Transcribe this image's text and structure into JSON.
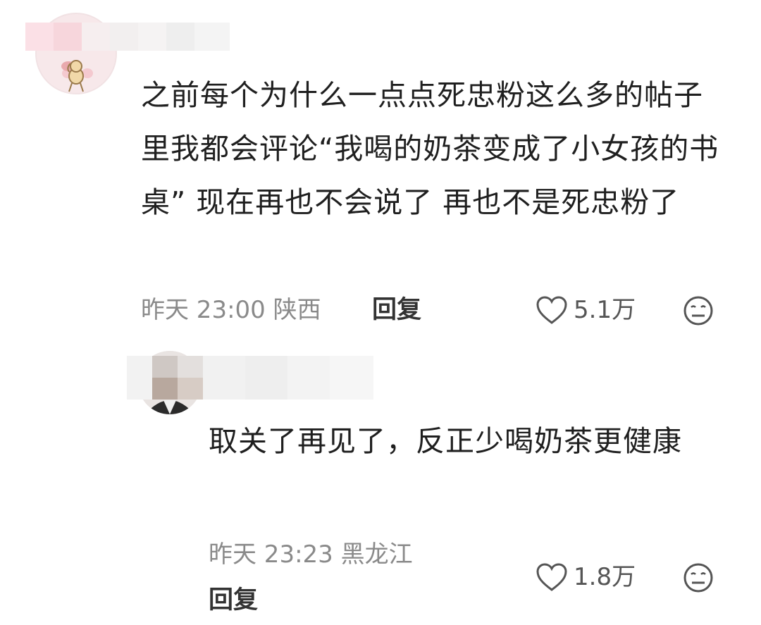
{
  "comments": [
    {
      "text": "之前每个为什么一点点死忠粉这么多的帖子里我都会评论“我喝的奶茶变成了小女孩的书桌” 现在再也不会说了 再也不是死忠粉了",
      "time": "昨天 23:00",
      "location": "陕西",
      "reply_label": "回复",
      "likes": "5.1万",
      "icons": {
        "like": "heart-outline-icon",
        "reaction": "neutral-face-icon"
      }
    },
    {
      "text": "取关了再见了，反正少喝奶茶更健康",
      "time": "昨天 23:23",
      "location": "黑龙江",
      "reply_label": "回复",
      "likes": "1.8万",
      "icons": {
        "like": "heart-outline-icon",
        "reaction": "neutral-face-icon"
      }
    }
  ],
  "colors": {
    "meta": "#8a8a8a",
    "text": "#1f1f1f",
    "icon": "#555555"
  }
}
